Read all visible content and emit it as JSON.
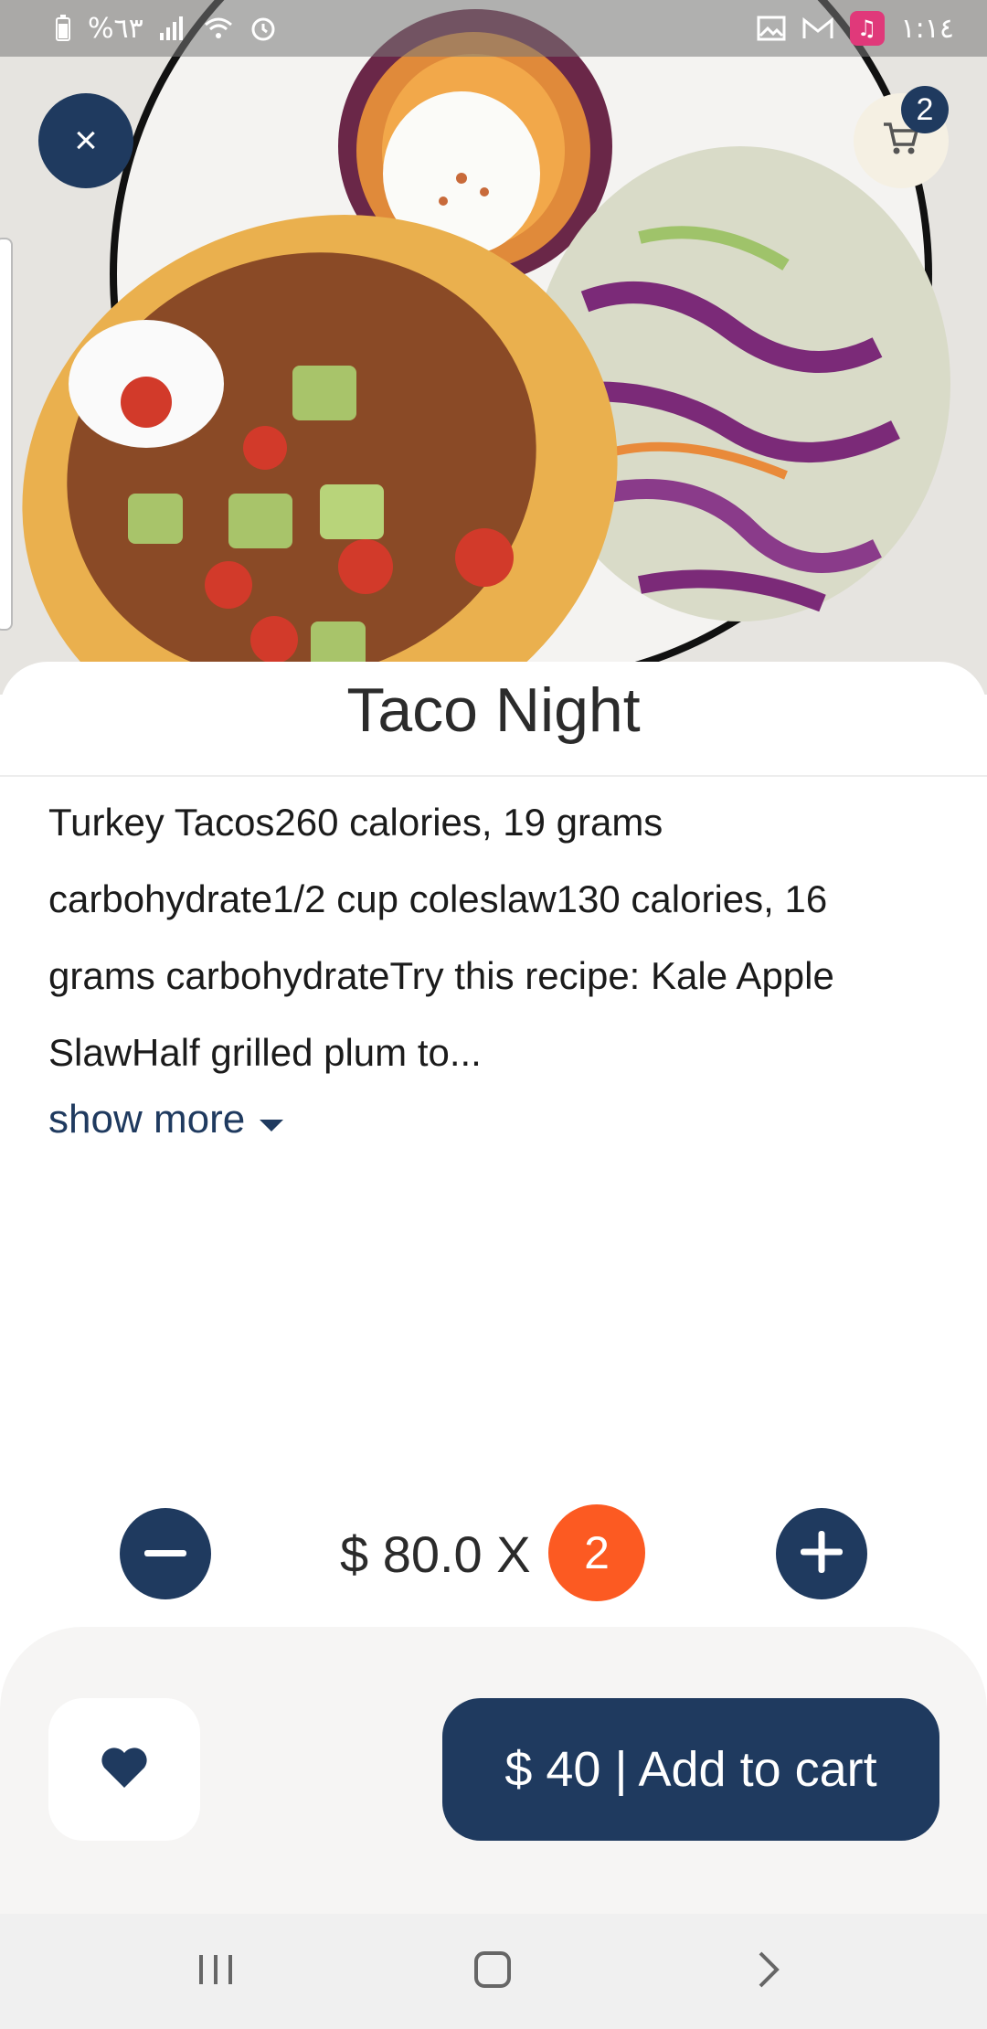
{
  "status_bar": {
    "battery": "%٦٣",
    "time": "١:١٤",
    "icons_left": [
      "battery-icon",
      "signal-icon",
      "wifi-icon",
      "alarm-icon"
    ],
    "icons_right": [
      "gallery-icon",
      "gmail-icon",
      "music-icon"
    ]
  },
  "header": {
    "close_icon": "×",
    "cart_count": "2"
  },
  "product": {
    "title": "Taco Night",
    "description": "Turkey Tacos260 calories, 19 grams carbohydrate1/2 cup coleslaw130 calories, 16 grams carbohydrateTry this recipe: Kale Apple SlawHalf grilled plum to...",
    "show_more": "show more"
  },
  "quantity": {
    "price_text": "$ 80.0 X",
    "count": "2"
  },
  "actions": {
    "add_to_cart": "$ 40 | Add to cart"
  },
  "colors": {
    "primary": "#1f3a5f",
    "accent": "#fc5a22",
    "cart_bg": "#f5f0e3",
    "panel_bg": "#f6f5f4"
  }
}
